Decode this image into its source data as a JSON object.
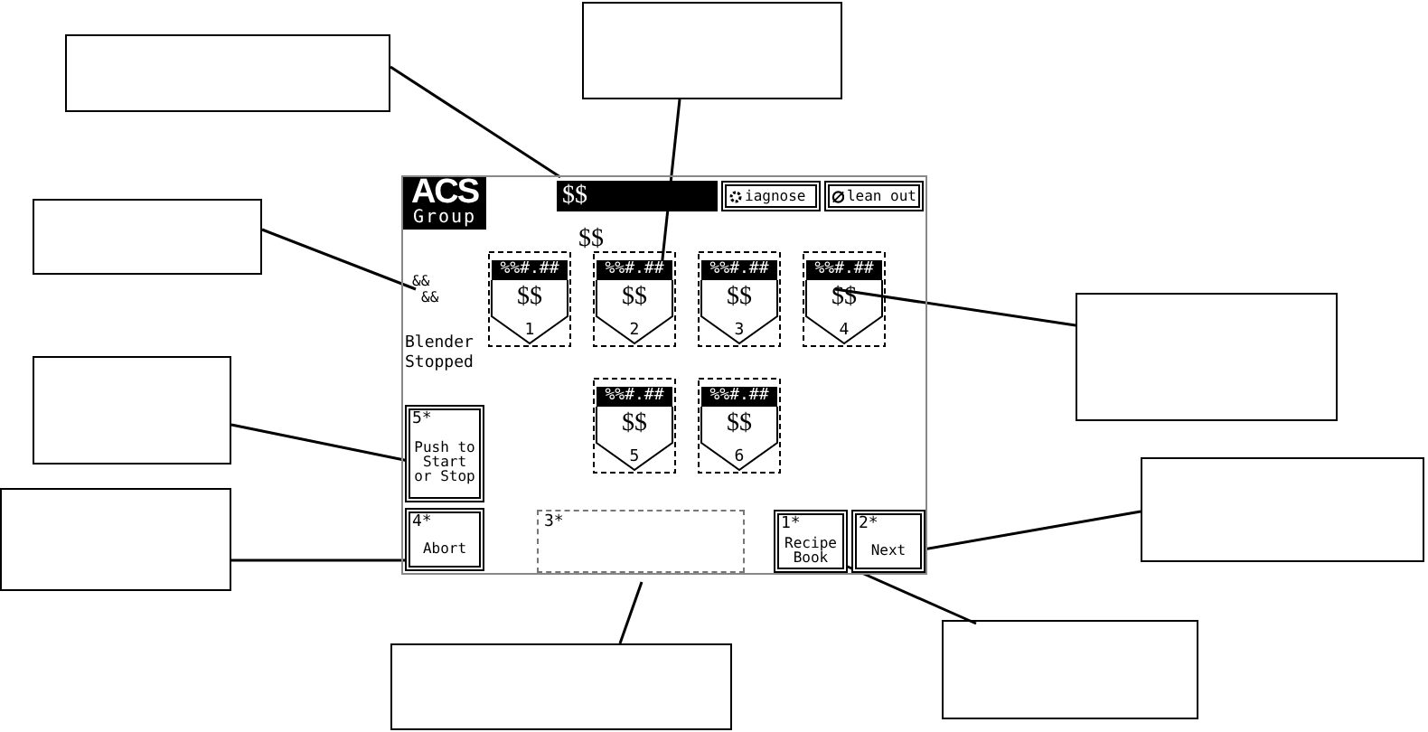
{
  "window": {
    "logo": "ACS",
    "logo_subtitle": "Group",
    "title": "$$"
  },
  "header_buttons": [
    {
      "label": "iagnose"
    },
    {
      "label": "lean out"
    }
  ],
  "subtitle": "$$",
  "status_codes": [
    "&&",
    "&&"
  ],
  "status": "Blender Stopped",
  "hoppers": [
    {
      "reading": "%%#.##",
      "name": "$$",
      "number": "1"
    },
    {
      "reading": "%%#.##",
      "name": "$$",
      "number": "2"
    },
    {
      "reading": "%%#.##",
      "name": "$$",
      "number": "3"
    },
    {
      "reading": "%%#.##",
      "name": "$$",
      "number": "4"
    },
    {
      "reading": "%%#.##",
      "name": "$$",
      "number": "5"
    },
    {
      "reading": "%%#.##",
      "name": "$$",
      "number": "6"
    }
  ],
  "buttons": [
    {
      "kind": "key",
      "key": "5*",
      "label": "Push to Start or Stop"
    },
    {
      "kind": "key",
      "key": "4*",
      "label": "Abort"
    },
    {
      "kind": "area",
      "key": "3*"
    },
    {
      "kind": "key",
      "key": "1*",
      "label": "Recipe Book"
    },
    {
      "kind": "key",
      "key": "2*",
      "label": "Next"
    }
  ]
}
